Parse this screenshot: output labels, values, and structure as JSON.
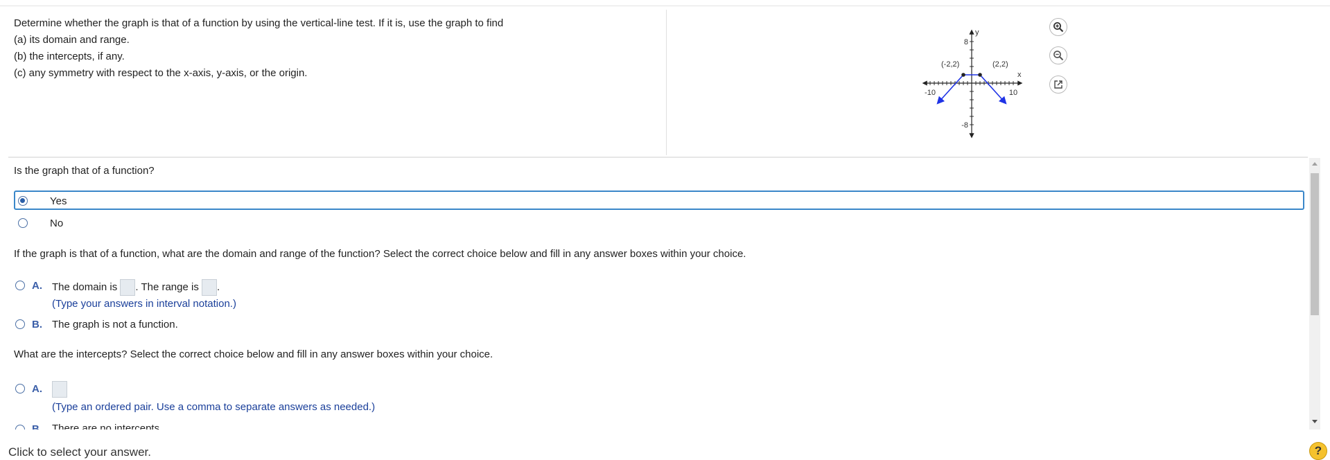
{
  "problem": {
    "lines": [
      "Determine whether the graph is that of a function by using the vertical-line test. If it is, use the graph to find",
      "(a) its domain and range.",
      "(b) the intercepts, if any.",
      "(c) any symmetry with respect to the x-axis, y-axis, or the origin."
    ]
  },
  "graph": {
    "y_axis_label": "y",
    "x_axis_label": "x",
    "y_max_label": "8",
    "y_min_label": "-8",
    "x_min_label": "-10",
    "x_max_label": "10",
    "point_left_label": "(-2,2)",
    "point_right_label": "(2,2)",
    "line_color": "#1f33e6"
  },
  "tools": {
    "zoom_in_icon": "zoom-in-icon",
    "zoom_out_icon": "zoom-out-icon",
    "popout_icon": "external-link-icon"
  },
  "q1": {
    "prompt": "Is the graph that of a function?",
    "options": [
      {
        "label": "Yes",
        "selected": true
      },
      {
        "label": "No",
        "selected": false
      }
    ]
  },
  "q2": {
    "prompt": "If the graph is that of a function, what are the domain and range of the function? Select the correct choice below and fill in any answer boxes within your choice.",
    "a_letter": "A.",
    "a_domain_text": "The domain is",
    "a_range_text": ". The range is",
    "a_end": ".",
    "a_hint": "(Type your answers in interval notation.)",
    "b_letter": "B.",
    "b_text": "The graph is not a function."
  },
  "q3": {
    "prompt": "What are the intercepts? Select the correct choice below and fill in any answer boxes within your choice.",
    "a_letter": "A.",
    "a_hint": "(Type an ordered pair. Use a comma to separate answers as needed.)",
    "b_letter": "B.",
    "b_text": "There are no intercepts."
  },
  "footer": {
    "status": "Click to select your answer.",
    "help_label": "?"
  }
}
